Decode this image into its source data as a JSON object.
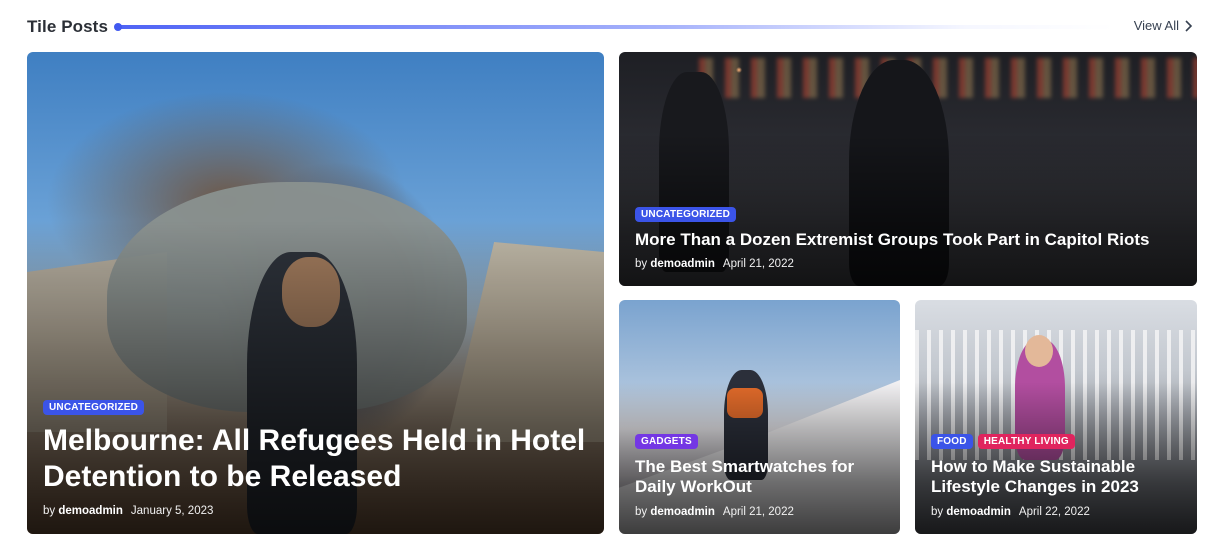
{
  "header": {
    "title": "Tile Posts",
    "view_all": "View All"
  },
  "colors": {
    "accent": "#4159f0",
    "tag_uncategorized": "#3b54e8",
    "tag_gadgets": "#7437e4",
    "tag_food": "#3b54e8",
    "tag_healthy_living": "#e0245e"
  },
  "posts": [
    {
      "tags": [
        "UNCATEGORIZED"
      ],
      "title": "Melbourne: All Refugees Held in Hotel Detention to be Released",
      "by": "by",
      "author": "demoadmin",
      "date": "January 5, 2023"
    },
    {
      "tags": [
        "UNCATEGORIZED"
      ],
      "title": "More Than a Dozen Extremist Groups Took Part in Capitol Riots",
      "by": "by",
      "author": "demoadmin",
      "date": "April 21, 2022"
    },
    {
      "tags": [
        "GADGETS"
      ],
      "title": "The Best Smartwatches for Daily WorkOut",
      "by": "by",
      "author": "demoadmin",
      "date": "April 21, 2022"
    },
    {
      "tags": [
        "FOOD",
        "HEALTHY LIVING"
      ],
      "title": "How to Make Sustainable Lifestyle Changes in 2023",
      "by": "by",
      "author": "demoadmin",
      "date": "April 22, 2022"
    }
  ]
}
